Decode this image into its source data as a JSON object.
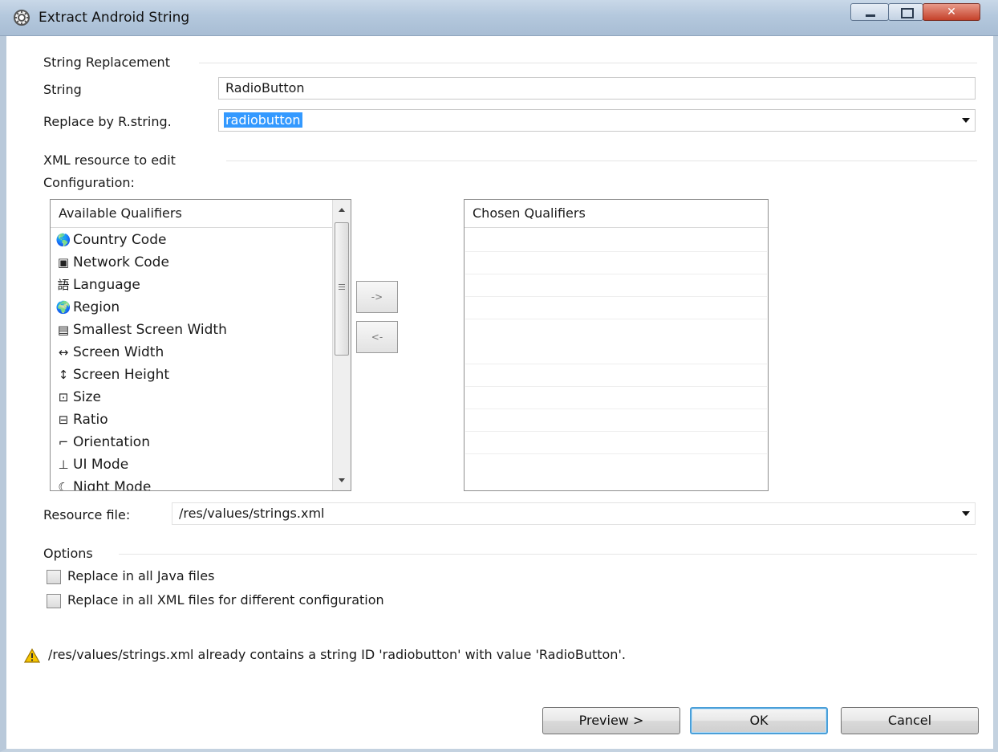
{
  "window": {
    "title": "Extract Android String"
  },
  "string_replacement": {
    "group_label": "String Replacement",
    "string_label": "String",
    "string_value": "RadioButton",
    "replace_label": "Replace by R.string.",
    "replace_value": "radiobutton"
  },
  "xml_resource": {
    "group_label": "XML resource to edit",
    "configuration_label": "Configuration:",
    "available_header": "Available Qualifiers",
    "chosen_header": "Chosen Qualifiers",
    "available_items": [
      {
        "label": "Country Code",
        "icon": "country-code-icon"
      },
      {
        "label": "Network Code",
        "icon": "network-code-icon"
      },
      {
        "label": "Language",
        "icon": "language-icon"
      },
      {
        "label": "Region",
        "icon": "region-icon"
      },
      {
        "label": "Smallest Screen Width",
        "icon": "smallest-screen-width-icon"
      },
      {
        "label": "Screen Width",
        "icon": "screen-width-icon"
      },
      {
        "label": "Screen Height",
        "icon": "screen-height-icon"
      },
      {
        "label": "Size",
        "icon": "size-icon"
      },
      {
        "label": "Ratio",
        "icon": "ratio-icon"
      },
      {
        "label": "Orientation",
        "icon": "orientation-icon"
      },
      {
        "label": "UI Mode",
        "icon": "ui-mode-icon"
      },
      {
        "label": "Night Mode",
        "icon": "night-mode-icon"
      }
    ],
    "add_button": "->",
    "remove_button": "<-",
    "resource_file_label": "Resource file:",
    "resource_file_value": "/res/values/strings.xml"
  },
  "options": {
    "group_label": "Options",
    "replace_java": "Replace in all Java files",
    "replace_xml": "Replace in all XML files for different configuration"
  },
  "warning": {
    "text": "/res/values/strings.xml already contains a string ID 'radiobutton' with value 'RadioButton'."
  },
  "buttons": {
    "preview": "Preview >",
    "ok": "OK",
    "cancel": "Cancel"
  },
  "colors": {
    "selection": "#3399ff",
    "default_button_border": "#4a9fd8",
    "warning": "#e8b400"
  }
}
